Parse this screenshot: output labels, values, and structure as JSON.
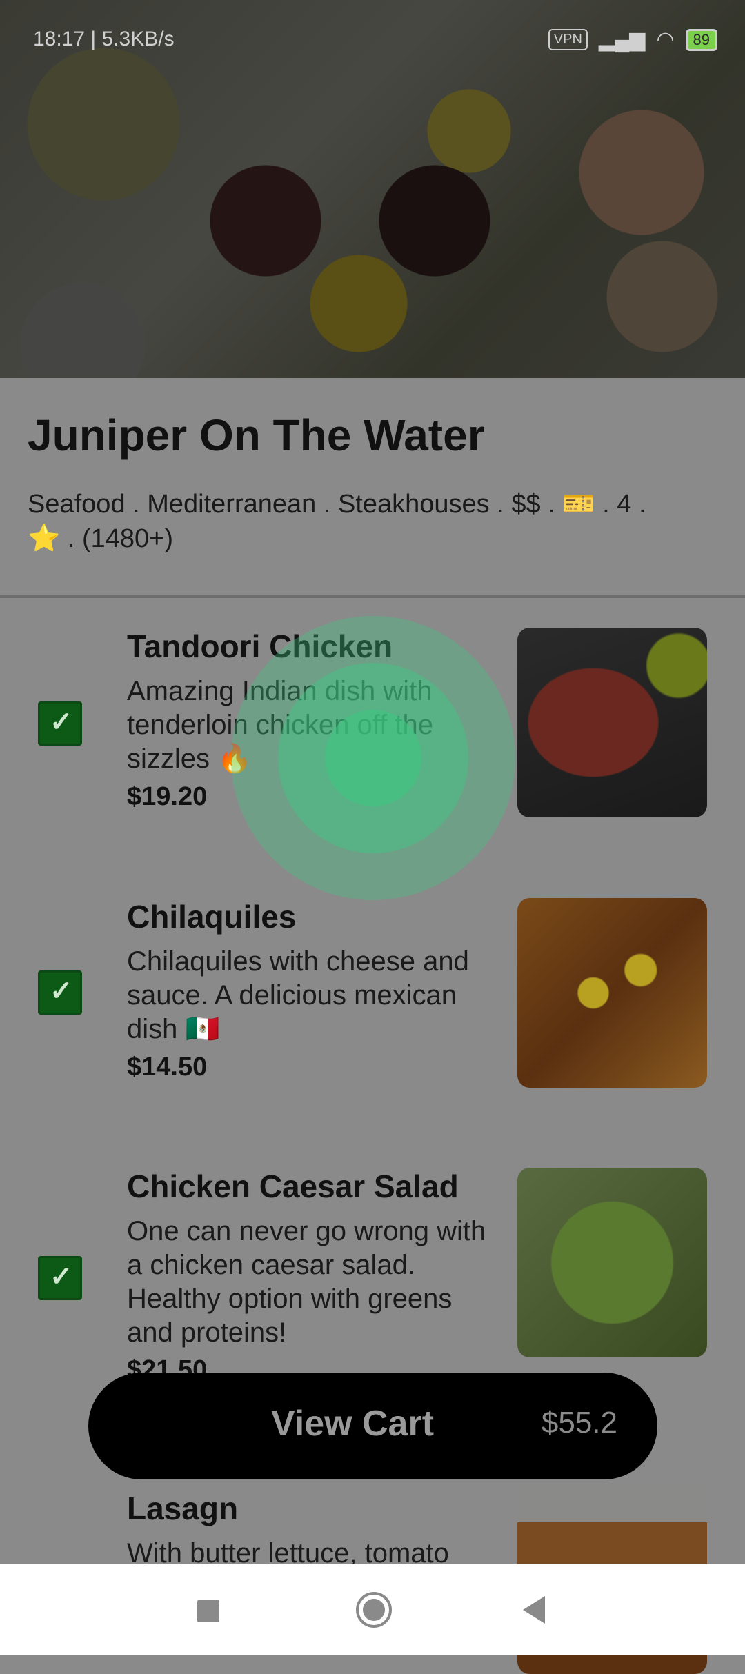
{
  "status": {
    "time_speed": "18:17 | 5.3KB/s",
    "vpn": "VPN",
    "battery": "89"
  },
  "restaurant": {
    "name": "Juniper On The Water",
    "meta_line1": "Seafood . Mediterranean . Steakhouses  . $$ . 🎫 . 4 .",
    "meta_line2": "⭐ . (1480+)"
  },
  "menu": [
    {
      "name": "Tandoori Chicken",
      "description": "Amazing Indian dish with tenderloin chicken off the sizzles 🔥",
      "price": "$19.20",
      "checked": true
    },
    {
      "name": "Chilaquiles",
      "description": "Chilaquiles with cheese and sauce. A delicious mexican dish 🇲🇽",
      "price": "$14.50",
      "checked": true
    },
    {
      "name": "Chicken Caesar Salad",
      "description": "One can never go wrong with a chicken caesar salad. Healthy option with greens and proteins!",
      "price": "$21.50",
      "checked": true
    },
    {
      "name": "Lasagn",
      "description": "With butter lettuce, tomato",
      "price": "",
      "checked": false
    }
  ],
  "cart": {
    "label": "View Cart",
    "total": "$55.2"
  },
  "icons": {
    "nav_recent": "square-icon",
    "nav_home": "home-circle-icon",
    "nav_back": "back-triangle-icon"
  }
}
